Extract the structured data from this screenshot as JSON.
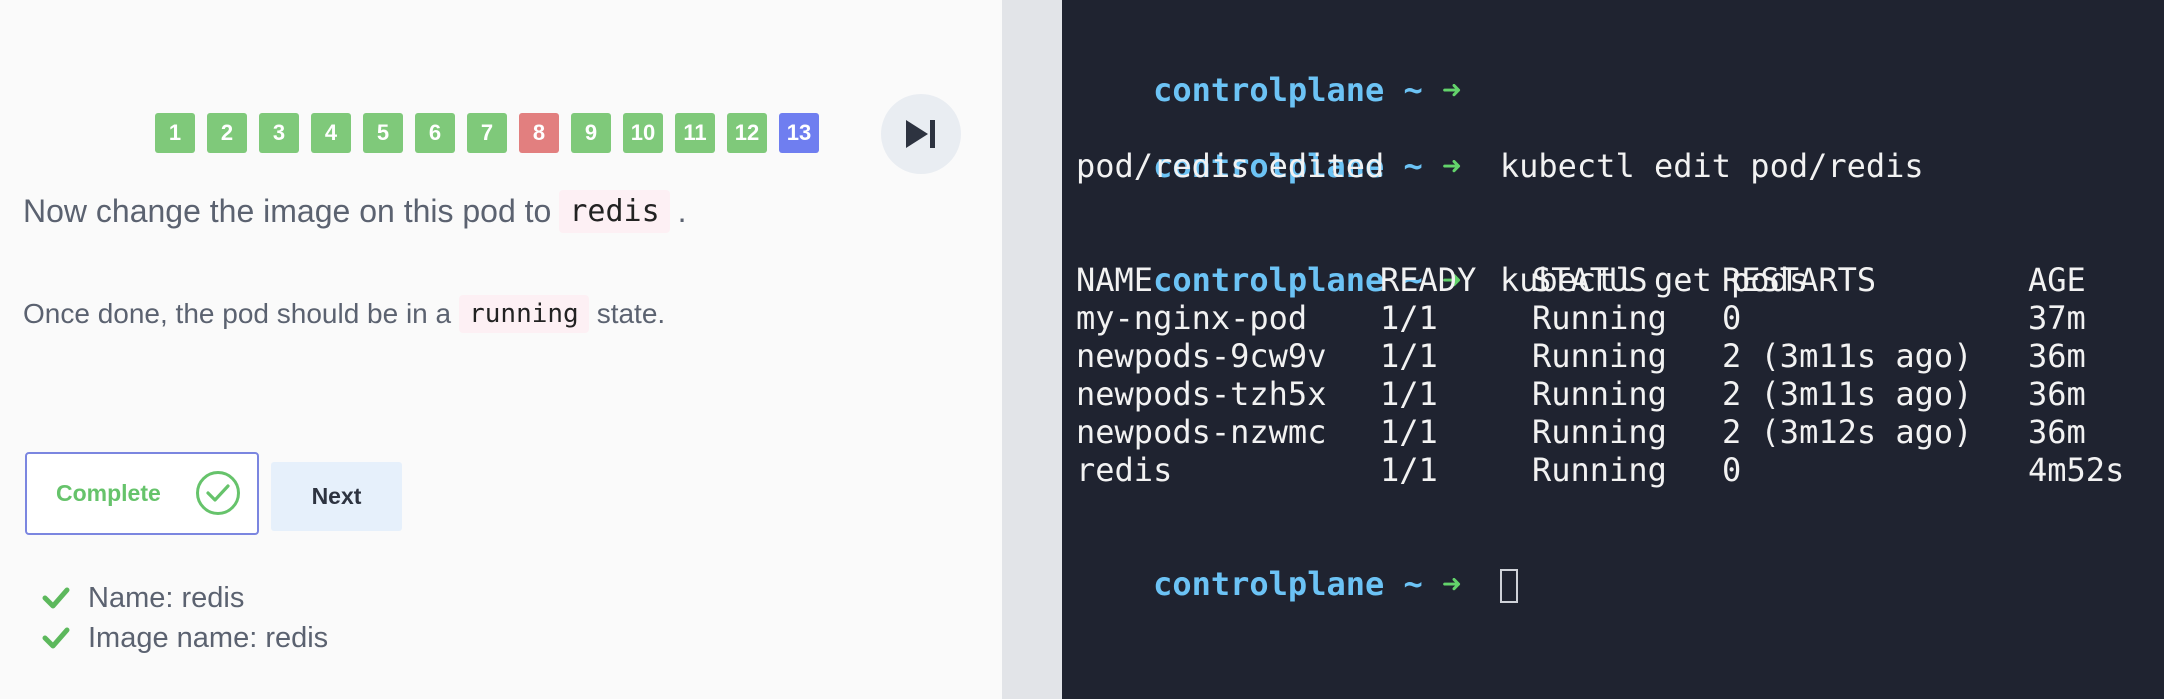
{
  "steps": [
    {
      "label": "1",
      "status": "done"
    },
    {
      "label": "2",
      "status": "done"
    },
    {
      "label": "3",
      "status": "done"
    },
    {
      "label": "4",
      "status": "done"
    },
    {
      "label": "5",
      "status": "done"
    },
    {
      "label": "6",
      "status": "done"
    },
    {
      "label": "7",
      "status": "done"
    },
    {
      "label": "8",
      "status": "failed"
    },
    {
      "label": "9",
      "status": "done"
    },
    {
      "label": "10",
      "status": "done"
    },
    {
      "label": "11",
      "status": "done"
    },
    {
      "label": "12",
      "status": "done"
    },
    {
      "label": "13",
      "status": "current"
    }
  ],
  "colors": {
    "done": "#7fc97a",
    "failed": "#e27f7f",
    "current": "#6f7ef0",
    "accent_green": "#66c36b",
    "terminal_bg": "#1f2330",
    "prompt_host": "#6cc3f5",
    "prompt_arrow": "#63d36b"
  },
  "task": {
    "instruction_prefix": "Now change the image on this pod to",
    "instruction_code": "redis",
    "instruction_suffix": ".",
    "note_prefix": "Once done, the pod should be in a",
    "note_code": "running",
    "note_suffix": "state."
  },
  "buttons": {
    "complete": "Complete",
    "next": "Next"
  },
  "checks": [
    {
      "text": "Name: redis"
    },
    {
      "text": "Image name: redis"
    }
  ],
  "terminal": {
    "prompt_host": "controlplane ~",
    "prompt_arrow": "➜",
    "commands": [
      "kubectl edit pod/redis",
      "kubectl get pods"
    ],
    "output_edit": "pod/redis edited",
    "table_headers": [
      "NAME",
      "READY",
      "STATUS",
      "RESTARTS",
      "AGE"
    ],
    "table_rows": [
      [
        "my-nginx-pod",
        "1/1",
        "Running",
        "0",
        "37m"
      ],
      [
        "newpods-9cw9v",
        "1/1",
        "Running",
        "2 (3m11s ago)",
        "36m"
      ],
      [
        "newpods-tzh5x",
        "1/1",
        "Running",
        "2 (3m11s ago)",
        "36m"
      ],
      [
        "newpods-nzwmc",
        "1/1",
        "Running",
        "2 (3m12s ago)",
        "36m"
      ],
      [
        "redis",
        "1/1",
        "Running",
        "0",
        "4m52s"
      ]
    ]
  }
}
